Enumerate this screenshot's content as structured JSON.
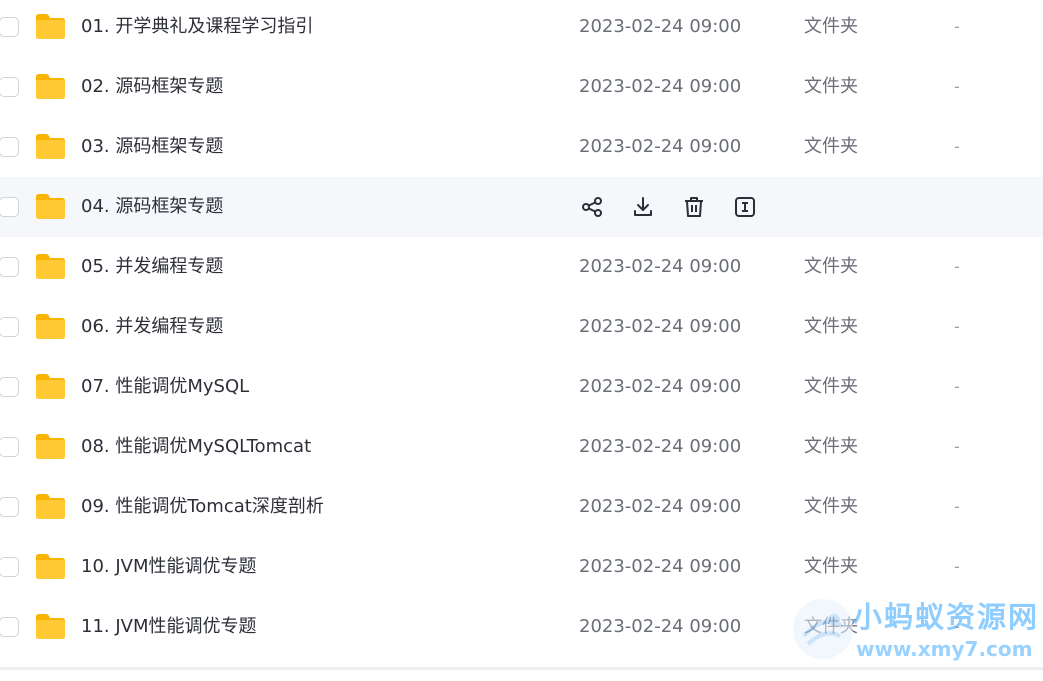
{
  "files": [
    {
      "name": "01. 开学典礼及课程学习指引",
      "date": "2023-02-24 09:00",
      "type": "文件夹",
      "size": "-"
    },
    {
      "name": "02. 源码框架专题",
      "date": "2023-02-24 09:00",
      "type": "文件夹",
      "size": "-"
    },
    {
      "name": "03. 源码框架专题",
      "date": "2023-02-24 09:00",
      "type": "文件夹",
      "size": "-"
    },
    {
      "name": "04. 源码框架专题",
      "date": "",
      "type": "",
      "size": ""
    },
    {
      "name": "05. 并发编程专题",
      "date": "2023-02-24 09:00",
      "type": "文件夹",
      "size": "-"
    },
    {
      "name": "06. 并发编程专题",
      "date": "2023-02-24 09:00",
      "type": "文件夹",
      "size": "-"
    },
    {
      "name": "07. 性能调优MySQL",
      "date": "2023-02-24 09:00",
      "type": "文件夹",
      "size": "-"
    },
    {
      "name": "08. 性能调优MySQLTomcat",
      "date": "2023-02-24 09:00",
      "type": "文件夹",
      "size": "-"
    },
    {
      "name": "09. 性能调优Tomcat深度剖析",
      "date": "2023-02-24 09:00",
      "type": "文件夹",
      "size": "-"
    },
    {
      "name": "10. JVM性能调优专题",
      "date": "2023-02-24 09:00",
      "type": "文件夹",
      "size": "-"
    },
    {
      "name": "11. JVM性能调优专题",
      "date": "2023-02-24 09:00",
      "type": "文件夹",
      "size": "-"
    }
  ],
  "hover_actions": [
    "share-icon",
    "download-icon",
    "delete-icon",
    "rename-icon"
  ],
  "watermark": {
    "title": "小蚂蚁资源网",
    "url": "www.xmy7.com"
  },
  "colors": {
    "folder": "#ffc933",
    "folder_back": "#f7b500",
    "hover_row": "#f5f7fb",
    "watermark": "#35a6ff"
  }
}
